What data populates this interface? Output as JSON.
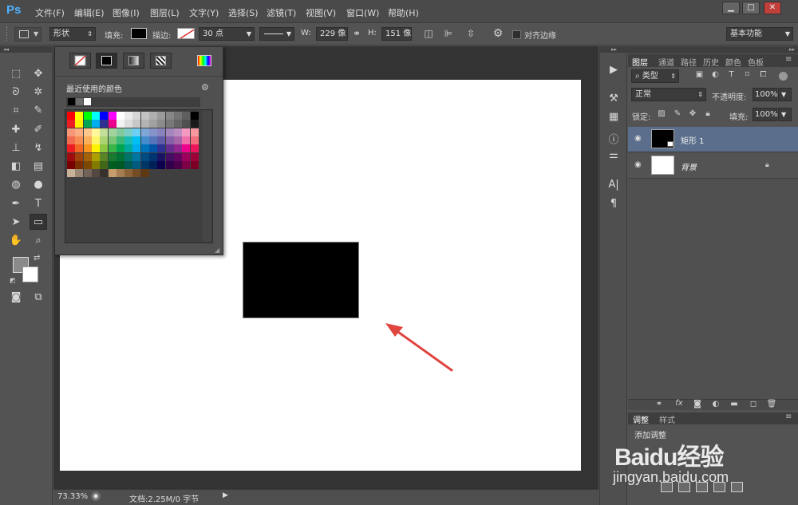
{
  "app": {
    "logo": "Ps"
  },
  "menu": [
    "文件(F)",
    "编辑(E)",
    "图像(I)",
    "图层(L)",
    "文字(Y)",
    "选择(S)",
    "滤镜(T)",
    "视图(V)",
    "窗口(W)",
    "帮助(H)"
  ],
  "window_buttons": {
    "minimize": "▁",
    "maximize": "□",
    "close": "✕"
  },
  "options": {
    "mode": "形状",
    "fill_label": "填充:",
    "stroke_label": "描边:",
    "stroke_width": "30 点",
    "w_label": "W:",
    "w_value": "229 像",
    "h_label": "H:",
    "h_value": "151 像",
    "align_edges": "对齐边缘",
    "workspace": "基本功能",
    "fill_color": "#000000"
  },
  "color_popup": {
    "recent_label": "最近使用的颜色",
    "recent_colors": [
      "#000000",
      "#6b6b6b",
      "#ffffff"
    ],
    "swatch_rows": [
      [
        "#ff0000",
        "#ffff00",
        "#00ff00",
        "#00ffff",
        "#0000ff",
        "#ff00ff",
        "#ffffff",
        "#ebebeb",
        "#d7d7d7",
        "#c3c3c3",
        "#afafaf",
        "#9b9b9b",
        "#878787",
        "#737373",
        "#5f5f5f",
        "#000000"
      ],
      [
        "#ed1c24",
        "#fff200",
        "#00a651",
        "#00aeef",
        "#2e3192",
        "#ec008c",
        "#f2f2f2",
        "#dddddd",
        "#c8c8c8",
        "#b4b4b4",
        "#a0a0a0",
        "#8c8c8c",
        "#787878",
        "#646464",
        "#505050",
        "#1a1a1a"
      ],
      [
        "#f7977a",
        "#f9ad81",
        "#fdc68a",
        "#fff79a",
        "#c4df9b",
        "#a3d39c",
        "#82ca9d",
        "#7bcdc8",
        "#6ecff6",
        "#7ea7d8",
        "#8493ca",
        "#8882be",
        "#a187be",
        "#bc8dbf",
        "#f49ac2",
        "#f6989d"
      ],
      [
        "#f26c4f",
        "#f68e56",
        "#fbaf5d",
        "#fff568",
        "#acd372",
        "#7cc576",
        "#3bb878",
        "#1abbb4",
        "#00bff3",
        "#448ccb",
        "#5674b9",
        "#605ca8",
        "#8560a8",
        "#a864a8",
        "#f06eaa",
        "#f26d7d"
      ],
      [
        "#ed1c24",
        "#f26522",
        "#f7941d",
        "#fff200",
        "#8dc63f",
        "#39b54a",
        "#00a651",
        "#00a99d",
        "#00aeef",
        "#0072bc",
        "#0054a6",
        "#2e3192",
        "#662d91",
        "#92278f",
        "#ec008c",
        "#ed145b"
      ],
      [
        "#9e0b0f",
        "#a0410d",
        "#a36209",
        "#aba000",
        "#598527",
        "#1a7b30",
        "#007236",
        "#00746b",
        "#0076a3",
        "#004b80",
        "#003471",
        "#1b1464",
        "#440e62",
        "#630460",
        "#9e005d",
        "#9e0039"
      ],
      [
        "#790000",
        "#7b2e00",
        "#7d4900",
        "#827b00",
        "#406618",
        "#005e20",
        "#005826",
        "#005952",
        "#005b7f",
        "#003663",
        "#002157",
        "#0d004c",
        "#32004b",
        "#4b0049",
        "#7b0046",
        "#7a0026"
      ],
      [
        "#c7b299",
        "#998675",
        "#736357",
        "#534741",
        "#37302d",
        "#c69c6d",
        "#a67c52",
        "#8c6239",
        "#754c24",
        "#603913"
      ]
    ]
  },
  "layers": {
    "tabs": [
      "图层",
      "通道",
      "路径",
      "历史",
      "颜色",
      "色板"
    ],
    "filter_kind": "类型",
    "blend_mode": "正常",
    "opacity_label": "不透明度:",
    "opacity": "100%",
    "lock_label": "锁定:",
    "fill_label": "填充:",
    "fill": "100%",
    "items": [
      {
        "name": "矩形 1",
        "selected": true
      },
      {
        "name": "背景",
        "selected": false
      }
    ]
  },
  "adjustments": {
    "tabs": [
      "调整",
      "样式"
    ],
    "add_label": "添加调整"
  },
  "status": {
    "zoom": "73.33%",
    "doc_info": "文档:2.25M/0 字节"
  },
  "watermark": {
    "brand": "Baidu经验",
    "url": "jingyan.baidu.com"
  }
}
